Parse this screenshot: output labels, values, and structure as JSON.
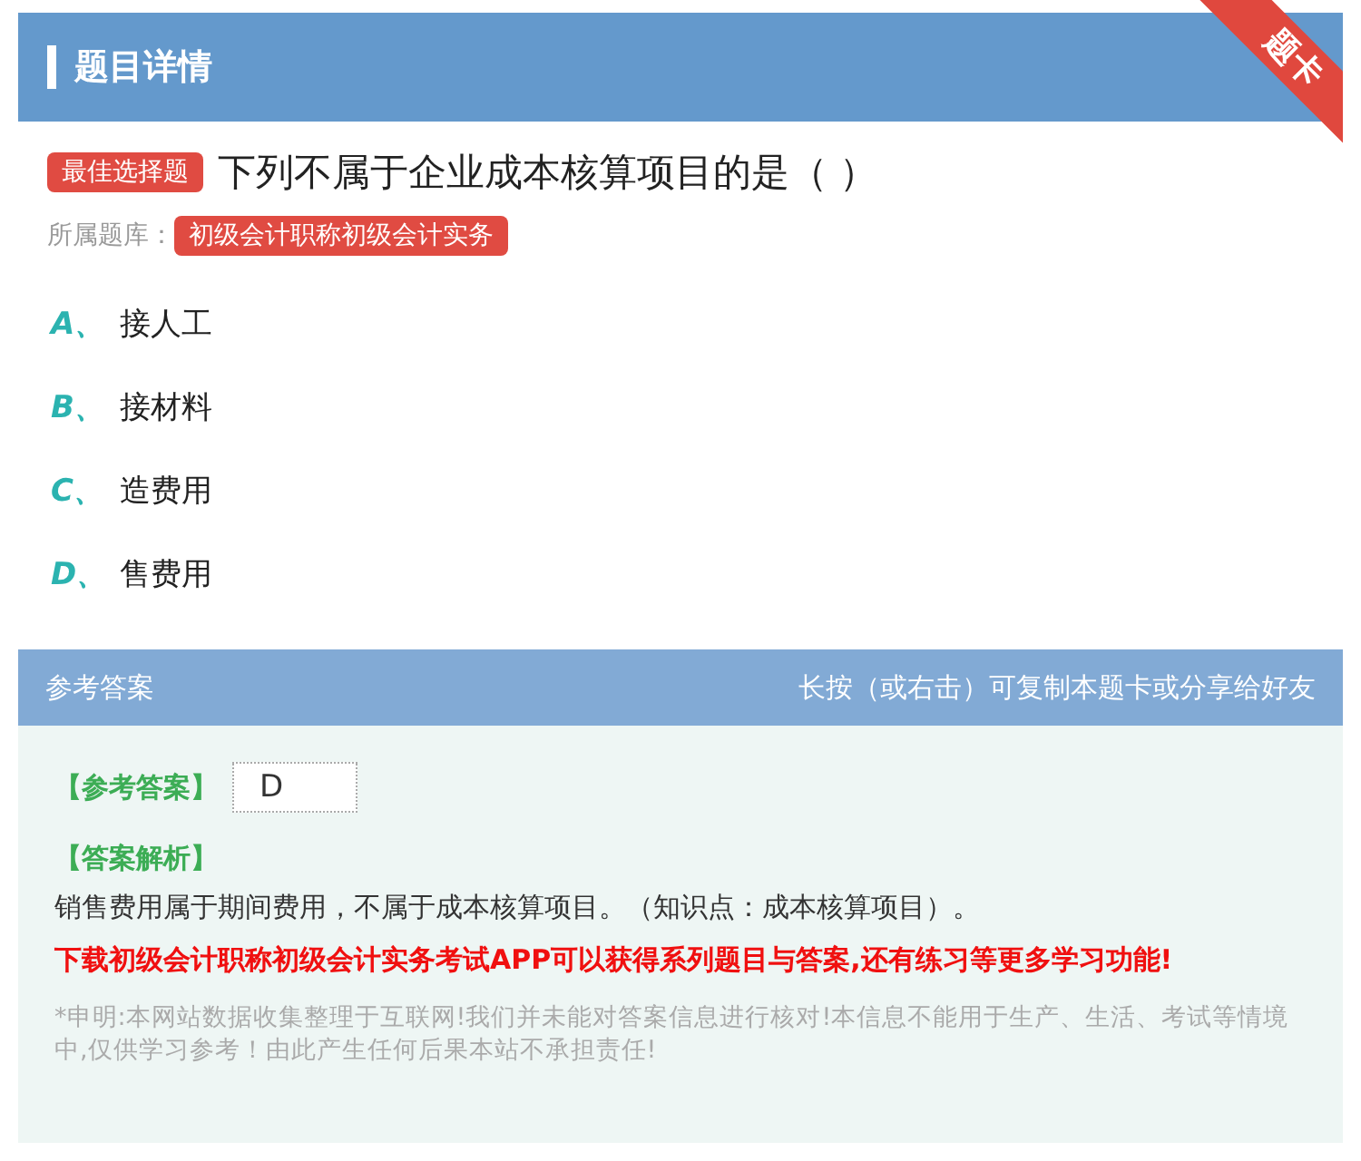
{
  "header": {
    "title": "题目详情",
    "ribbon": "题卡"
  },
  "question": {
    "type_tag": "最佳选择题",
    "text": "下列不属于企业成本核算项目的是（  ）",
    "source_label": "所属题库：",
    "source_tag": "初级会计职称初级会计实务"
  },
  "options": [
    {
      "letter": "A、",
      "text": "接人工"
    },
    {
      "letter": "B、",
      "text": "接材料"
    },
    {
      "letter": "C、",
      "text": "造费用"
    },
    {
      "letter": "D、",
      "text": "售费用"
    }
  ],
  "answer_section": {
    "title": "参考答案",
    "hint": "长按（或右击）可复制本题卡或分享给好友",
    "answer_label": "【参考答案】",
    "answer_value": "D",
    "analysis_label": "【答案解析】",
    "analysis": "销售费用属于期间费用，不属于成本核算项目。（知识点：成本核算项目）。",
    "promo": "下载初级会计职称初级会计实务考试APP可以获得系列题目与答案,还有练习等更多学习功能!",
    "disclaimer": "*申明:本网站数据收集整理于互联网!我们并未能对答案信息进行核对!本信息不能用于生产、生活、考试等情境中,仅供学习参考！由此产生任何后果本站不承担责任!"
  }
}
